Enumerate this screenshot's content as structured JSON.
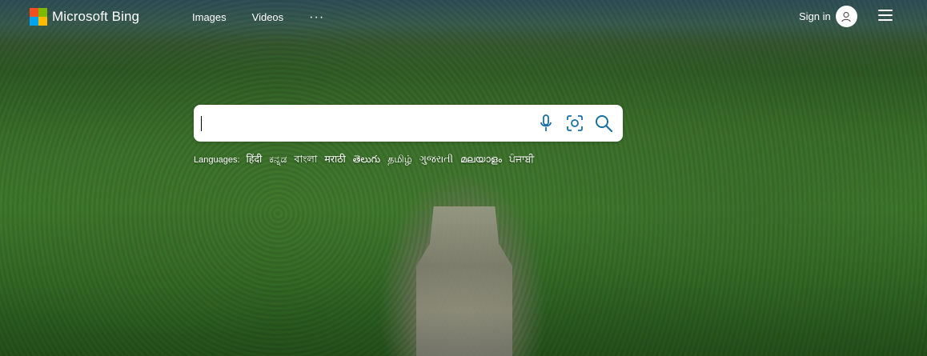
{
  "header": {
    "brand": "Microsoft Bing",
    "logo_colors": [
      "#f25022",
      "#7fba00",
      "#00a4ef",
      "#ffb900"
    ],
    "nav": [
      {
        "label": "Images"
      },
      {
        "label": "Videos"
      }
    ],
    "more_label": "···",
    "signin_label": "Sign in"
  },
  "search": {
    "value": "",
    "placeholder": "",
    "icons": [
      "microphone-icon",
      "visual-search-icon",
      "search-icon"
    ],
    "accent": "#1a6fa3"
  },
  "languages": {
    "label": "Languages:",
    "items": [
      "हिंदी",
      "ಕನ್ನಡ",
      "বাংলা",
      "मराठी",
      "తెలుగు",
      "தமிழ்",
      "ગુજરાતી",
      "മലയാളം",
      "ਪੰਜਾਬੀ"
    ]
  }
}
